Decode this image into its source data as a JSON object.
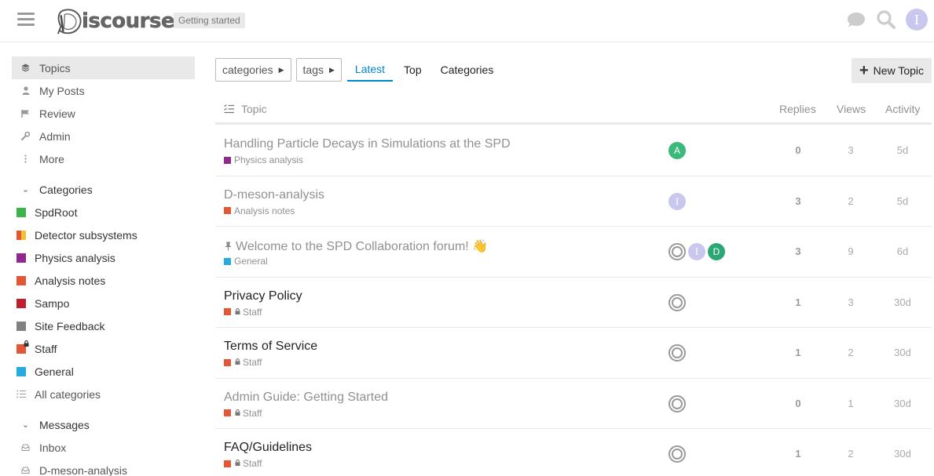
{
  "header": {
    "logo_text": "iscourse",
    "breadcrumb": "Getting started",
    "icons": [
      "hamburger-icon",
      "chat-icon",
      "search-icon",
      "user-avatar"
    ],
    "user_initial": "I"
  },
  "sidebar": {
    "items": [
      {
        "label": "Topics",
        "icon": "layers-icon"
      },
      {
        "label": "My Posts",
        "icon": "user-icon"
      },
      {
        "label": "Review",
        "icon": "flag-icon"
      },
      {
        "label": "Admin",
        "icon": "wrench-icon"
      },
      {
        "label": "More",
        "icon": "vertical-dots-icon"
      }
    ],
    "categories_header": "Categories",
    "categories": [
      {
        "label": "SpdRoot",
        "color": "#3ab54a"
      },
      {
        "label": "Detector subsystems",
        "color": "#f1c232/#e45735"
      },
      {
        "label": "Physics analysis",
        "color": "#92278f"
      },
      {
        "label": "Analysis notes",
        "color": "#e45735"
      },
      {
        "label": "Sampo",
        "color": "#bf1e2e"
      },
      {
        "label": "Site Feedback",
        "color": "#808281"
      },
      {
        "label": "Staff",
        "color": "#e45735"
      },
      {
        "label": "General",
        "color": "#25aae2"
      },
      {
        "label": "All categories",
        "icon": "list-icon"
      }
    ],
    "messages_header": "Messages",
    "messages": [
      {
        "label": "Inbox",
        "icon": "inbox-icon"
      },
      {
        "label": "D-meson-analysis",
        "icon": "inbox-icon"
      }
    ]
  },
  "nav": {
    "categories_dropdown": "categories",
    "tags_dropdown": "tags",
    "tabs": [
      "Latest",
      "Top",
      "Categories"
    ],
    "active_tab": "Latest",
    "new_topic": "New Topic"
  },
  "table": {
    "headers": {
      "topic": "Topic",
      "replies": "Replies",
      "views": "Views",
      "activity": "Activity"
    },
    "rows": [
      {
        "title": "Handling Particle Decays in Simulations at the SPD",
        "category": "Physics analysis",
        "cat_color": "#92278f",
        "posters": [
          {
            "letter": "A",
            "color": "#3ab97a"
          }
        ],
        "replies": "0",
        "views": "3",
        "activity": "5d",
        "read": true
      },
      {
        "title": "D-meson-analysis",
        "category": "Analysis notes",
        "cat_color": "#e45735",
        "posters": [
          {
            "letter": "I",
            "color": "#c9c7ee"
          }
        ],
        "replies": "3",
        "views": "2",
        "activity": "5d",
        "read": true
      },
      {
        "title": "Welcome to the SPD Collaboration forum! 👋",
        "category": "General",
        "cat_color": "#25aae2",
        "pinned": true,
        "posters": [
          {
            "letter": "",
            "color": "system"
          },
          {
            "letter": "I",
            "color": "#c9c7ee"
          },
          {
            "letter": "D",
            "color": "#2ba775"
          }
        ],
        "replies": "3",
        "views": "9",
        "activity": "6d",
        "read": true
      },
      {
        "title": "Privacy Policy",
        "category": "Staff",
        "cat_color": "#e45735",
        "locked": true,
        "posters": [
          {
            "letter": "",
            "color": "system"
          }
        ],
        "replies": "1",
        "views": "3",
        "activity": "30d",
        "read": false
      },
      {
        "title": "Terms of Service",
        "category": "Staff",
        "cat_color": "#e45735",
        "locked": true,
        "posters": [
          {
            "letter": "",
            "color": "system"
          }
        ],
        "replies": "1",
        "views": "2",
        "activity": "30d",
        "read": false
      },
      {
        "title": "Admin Guide: Getting Started",
        "category": "Staff",
        "cat_color": "#e45735",
        "locked": true,
        "posters": [
          {
            "letter": "",
            "color": "system"
          }
        ],
        "replies": "0",
        "views": "1",
        "activity": "30d",
        "read": true
      },
      {
        "title": "FAQ/Guidelines",
        "category": "Staff",
        "cat_color": "#e45735",
        "locked": true,
        "posters": [
          {
            "letter": "",
            "color": "system"
          }
        ],
        "replies": "1",
        "views": "2",
        "activity": "30d",
        "read": false
      }
    ]
  }
}
